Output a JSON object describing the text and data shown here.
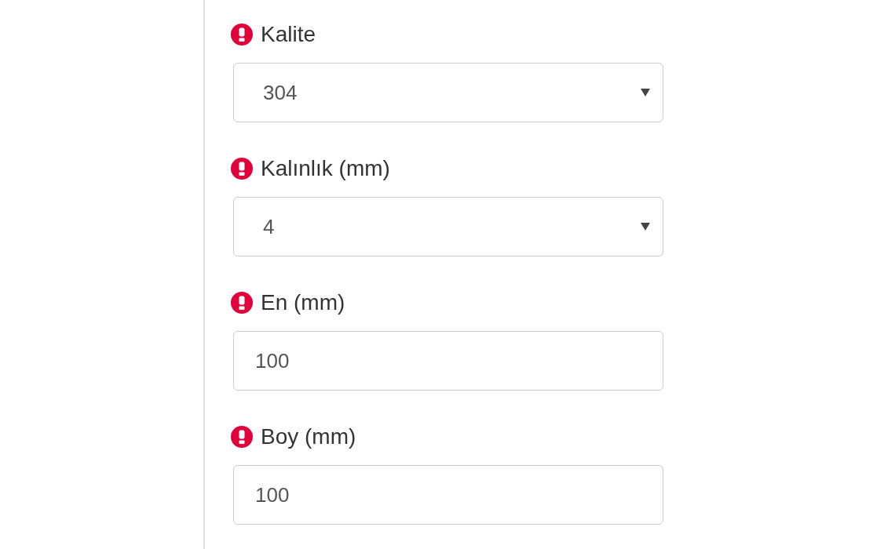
{
  "fields": [
    {
      "label": "Kalite",
      "required": true,
      "kind": "select",
      "value": "304"
    },
    {
      "label": "Kalınlık (mm)",
      "required": true,
      "kind": "select",
      "value": "4"
    },
    {
      "label": "En (mm)",
      "required": true,
      "kind": "input",
      "value": "100"
    },
    {
      "label": "Boy (mm)",
      "required": true,
      "kind": "input",
      "value": "100"
    }
  ]
}
